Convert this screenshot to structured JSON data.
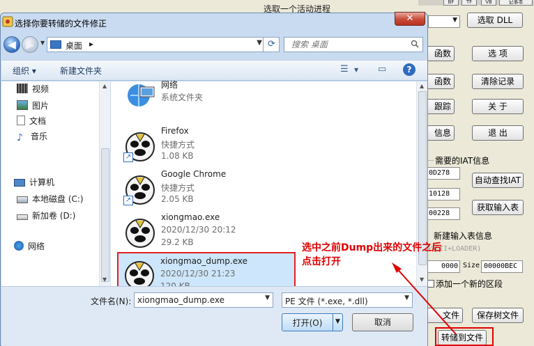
{
  "background_app": {
    "header": "选取一个活动进程",
    "top_buttons": [
      "BF",
      "TF",
      "VB",
      "记事本"
    ],
    "buttons": {
      "select_dll": "选取 DLL",
      "partial_func1": "函数",
      "partial_func2": "函数",
      "partial_trace": "跟踪",
      "partial_info": "信息",
      "option": "选  项",
      "clear_log": "清除记录",
      "about": "关  于",
      "exit": "退  出",
      "auto_find_iat": "自动查找IAT",
      "get_import_table": "获取输入表",
      "partial_file": "文件",
      "save_tree": "保存树文件",
      "dump_to_file": "转储到文件"
    },
    "iat_section": "需要的IAT信息",
    "iat_values": [
      "0D278",
      "10128",
      "00228"
    ],
    "new_import_section": "新建输入表信息",
    "ascii_loader": "ASCII+LOADER)",
    "field_value": "0000",
    "size_label": "Size",
    "size_value": "00000BEC",
    "add_section": "添加一个新的区段"
  },
  "dialog": {
    "title": "选择你要转储的文件修正",
    "close": "✕",
    "path": "桌面",
    "path_sep": "▸",
    "search_placeholder": "搜索 桌面",
    "toolbar": {
      "organize": "组织 ▾",
      "new_folder": "新建文件夹"
    },
    "nav": {
      "videos": "视频",
      "pictures": "图片",
      "documents": "文档",
      "music": "音乐",
      "computer": "计算机",
      "local_disk": "本地磁盘 (C:)",
      "new_volume": "新加卷 (D:)",
      "network": "网络"
    },
    "files": [
      {
        "name": "网络",
        "type": "系统文件夹",
        "size": ""
      },
      {
        "name": "Firefox",
        "type": "快捷方式",
        "size": "1.08 KB"
      },
      {
        "name": "Google Chrome",
        "type": "快捷方式",
        "size": "2.05 KB"
      },
      {
        "name": "xiongmao.exe",
        "type": "2020/12/30 20:12",
        "size": "29.2 KB"
      },
      {
        "name": "xiongmao_dump.exe",
        "type": "2020/12/30 21:23",
        "size": "120 KB"
      }
    ],
    "filename_label": "文件名(N):",
    "filename_value": "xiongmao_dump.exe",
    "filetype_value": "PE 文件 (*.exe, *.dll)",
    "open_label": "打开(O)",
    "cancel_label": "取消"
  },
  "annotation": {
    "line1": "选中之前Dump出来的文件之后",
    "line2": "点击打开"
  },
  "colors": {
    "annotation": "#e00000",
    "selection": "#cde6fb"
  }
}
